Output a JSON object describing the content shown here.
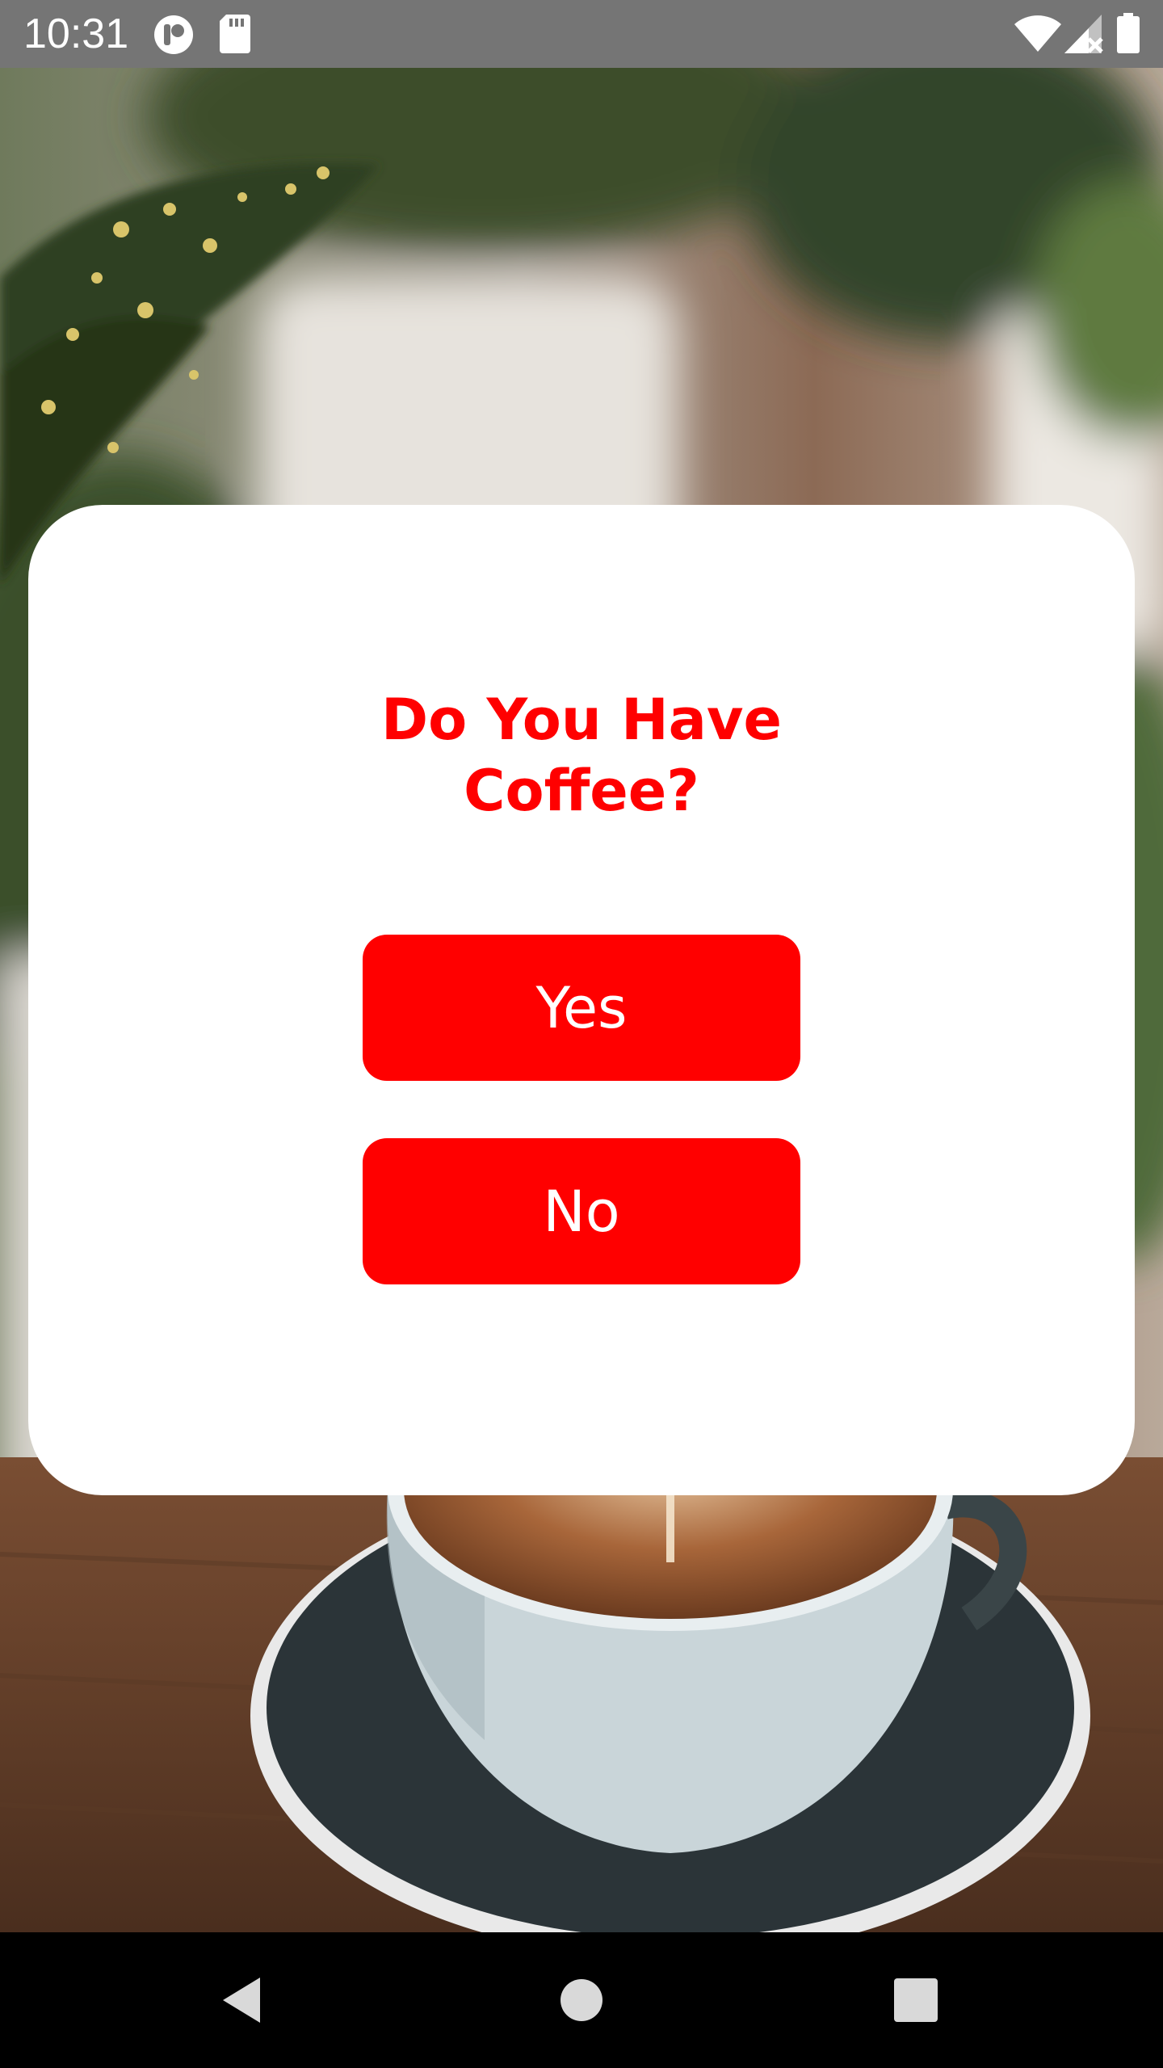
{
  "status_bar": {
    "time": "10:31",
    "icons": [
      "app-badge-icon",
      "sd-card-icon",
      "wifi-icon",
      "cell-signal-icon",
      "battery-icon"
    ],
    "background_color": "#757575"
  },
  "background": {
    "description_icon": "coffee-latte-photo"
  },
  "dialog": {
    "title_line1": "Do You Have",
    "title_line2": "Coffee?",
    "yes_label": "Yes",
    "no_label": "No",
    "accent_color": "#ff0000"
  },
  "nav_bar": {
    "icons": [
      "back-icon",
      "home-icon",
      "recents-icon"
    ]
  }
}
